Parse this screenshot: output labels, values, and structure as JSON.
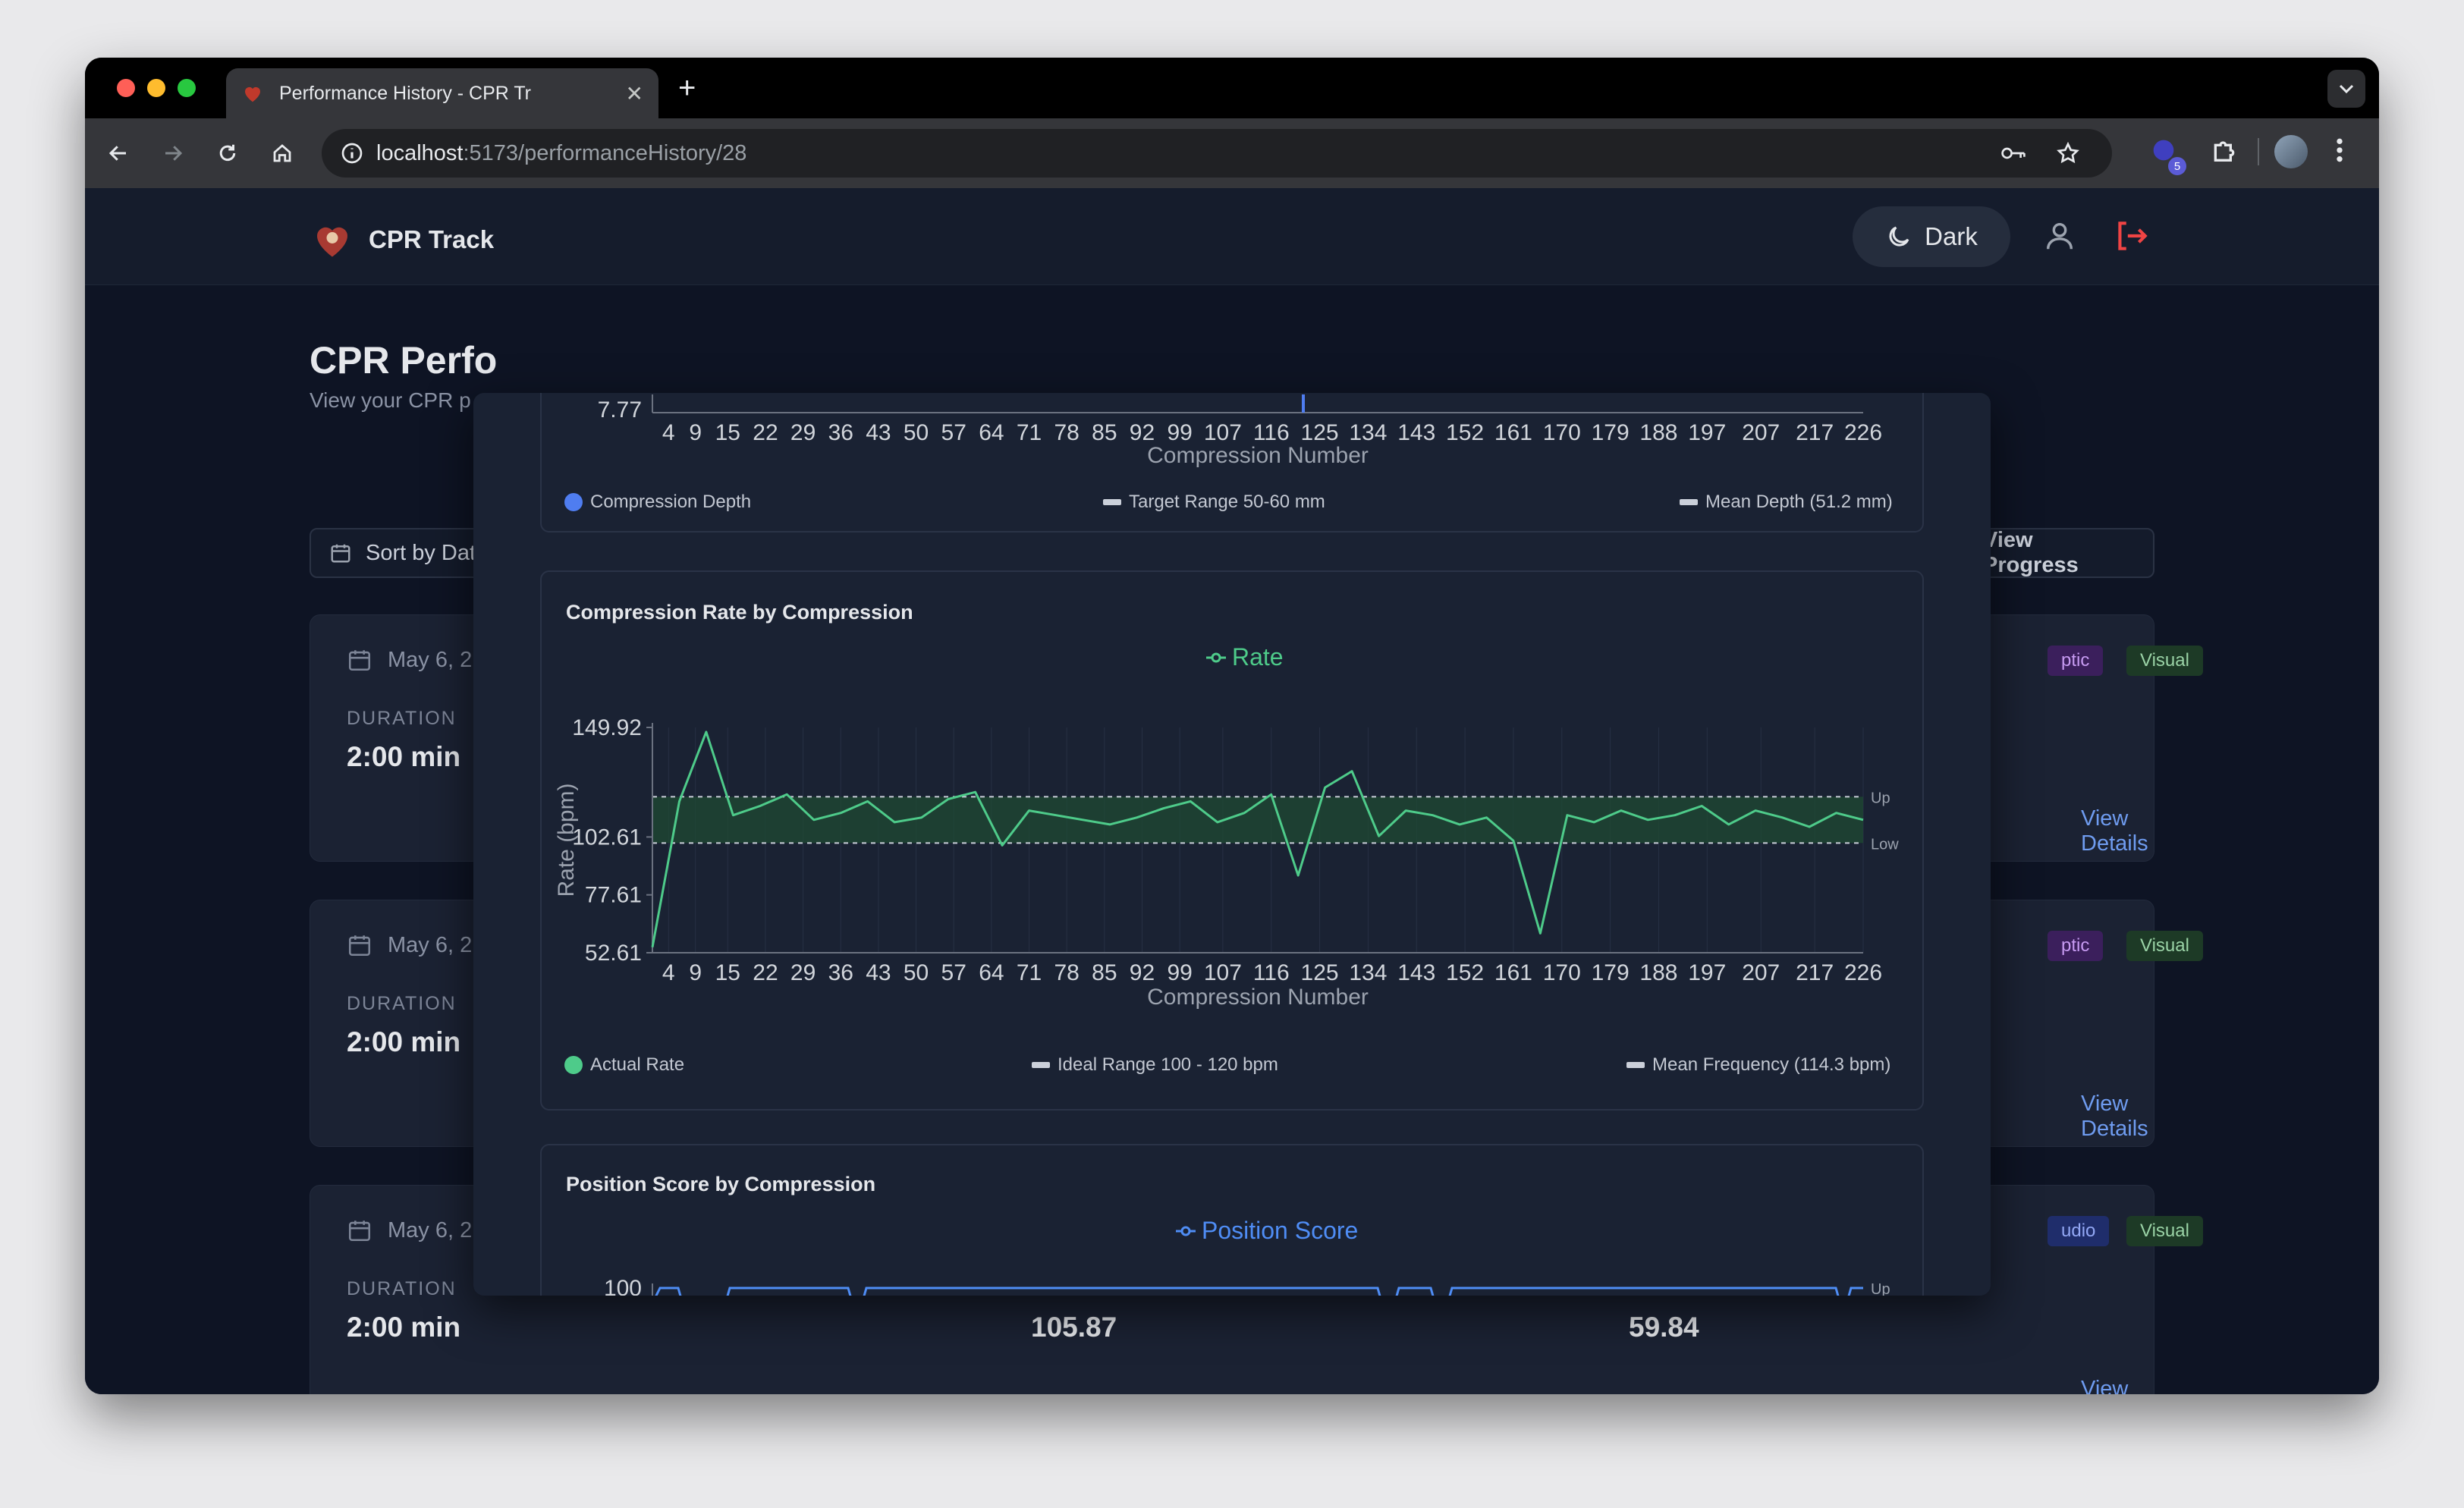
{
  "browser": {
    "tab_title": "Performance History - CPR Tr",
    "url_host": "localhost",
    "url_path": ":5173/performanceHistory/28",
    "extension_badge": "5"
  },
  "app": {
    "brand": "CPR Track",
    "theme_label": "Dark",
    "page_title": "CPR Perfo",
    "page_subtitle": "View your CPR p",
    "sort_label": "Sort by Dat",
    "progress_label": "View Progress",
    "sessions": [
      {
        "date": "May 6, 2",
        "duration_label": "DURATION",
        "duration": "2:00 min",
        "badges": [
          "ptic",
          "Visual"
        ],
        "view_details": "View Details"
      },
      {
        "date": "May 6, 2",
        "duration_label": "DURATION",
        "duration": "2:00 min",
        "badges": [
          "ptic",
          "Visual"
        ],
        "view_details": "View Details"
      },
      {
        "date": "May 6, 2",
        "duration_label": "DURATION",
        "duration": "2:00 min",
        "badges": [
          "udio",
          "Visual"
        ],
        "view_details": "View Details",
        "metrics": [
          "105.87",
          "59.84"
        ]
      }
    ]
  },
  "modal": {
    "depth_chart": {
      "ytick_bottom": "7.77",
      "xlabel": "Compression Number",
      "legend": [
        "Compression Depth",
        "Target Range 50-60 mm",
        "Mean Depth (51.2 mm)"
      ]
    },
    "rate_card_title": "Compression Rate by Compression",
    "rate_legend": [
      "Actual Rate",
      "Ideal Range 100 - 120 bpm",
      "Mean Frequency (114.3 bpm)"
    ],
    "position_card_title": "Position Score by Compression"
  },
  "colors": {
    "rate": "#4ecb8a",
    "depth": "#4f7df0",
    "position": "#4f8df5",
    "accent_link": "#6f9cf0"
  },
  "chart_data": [
    {
      "type": "line",
      "title": "",
      "series": [
        {
          "name": "Rate"
        }
      ],
      "xlabel": "Compression Number",
      "ylabel": "Rate (bpm)",
      "x_ticks": [
        4,
        9,
        15,
        22,
        29,
        36,
        43,
        50,
        57,
        64,
        71,
        78,
        85,
        92,
        99,
        107,
        116,
        125,
        134,
        143,
        152,
        161,
        170,
        179,
        188,
        197,
        207,
        217,
        226
      ],
      "y_ticks": [
        "149.92",
        "102.61",
        "77.61",
        "52.61"
      ],
      "ylim": [
        52.61,
        149.92
      ],
      "reference_lines": [
        {
          "label": "Up",
          "value": 120
        },
        {
          "label": "Low",
          "value": 100
        }
      ],
      "x": [
        1,
        6,
        11,
        16,
        21,
        26,
        31,
        36,
        41,
        46,
        51,
        56,
        61,
        66,
        71,
        76,
        81,
        86,
        91,
        96,
        101,
        106,
        111,
        116,
        121,
        126,
        131,
        136,
        141,
        146,
        151,
        156,
        161,
        166,
        171,
        176,
        181,
        186,
        191,
        196,
        201,
        206,
        211,
        216,
        221,
        226
      ],
      "values": [
        55,
        118,
        148,
        112,
        116,
        121,
        110,
        113,
        118,
        109,
        111,
        119,
        122,
        99,
        114,
        112,
        110,
        108,
        111,
        115,
        118,
        109,
        113,
        121,
        86,
        124,
        131,
        103,
        114,
        112,
        108,
        111,
        101,
        61,
        112,
        109,
        114,
        110,
        112,
        116,
        108,
        114,
        111,
        107,
        113,
        110
      ]
    },
    {
      "type": "line",
      "series": [
        {
          "name": "Position Score"
        }
      ],
      "y_ticks": [
        "100"
      ],
      "reference_lines": [
        {
          "label": "Up"
        }
      ]
    }
  ]
}
